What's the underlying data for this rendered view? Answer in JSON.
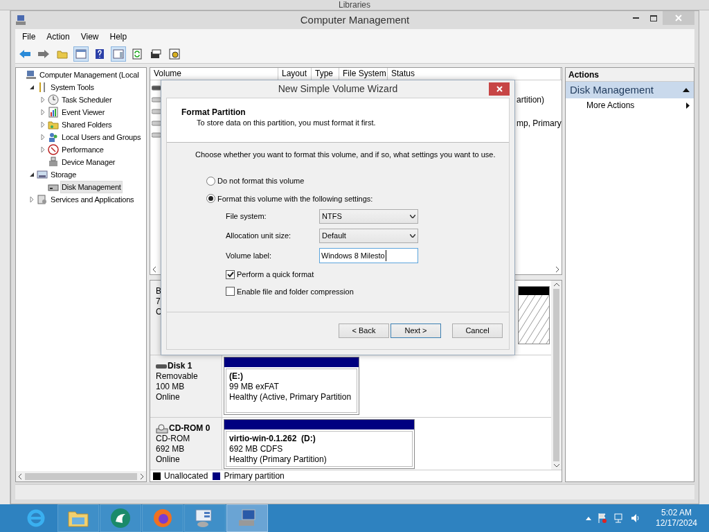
{
  "background_window": {
    "title": "Libraries"
  },
  "window": {
    "title": "Computer Management"
  },
  "menu": [
    "File",
    "Action",
    "View",
    "Help"
  ],
  "toolbar": [
    {
      "kind": "back",
      "pressed": false
    },
    {
      "kind": "forward",
      "pressed": false
    },
    {
      "kind": "folder",
      "pressed": false
    },
    {
      "kind": "console",
      "pressed": true
    },
    {
      "kind": "help",
      "pressed": false
    },
    {
      "kind": "panel",
      "pressed": true
    },
    {
      "kind": "refresh",
      "pressed": false
    },
    {
      "kind": "properties",
      "pressed": false
    },
    {
      "kind": "settings",
      "pressed": false
    }
  ],
  "tree": [
    {
      "label": "Computer Management (Local",
      "kind": "computer",
      "selected": false,
      "children": [
        {
          "label": "System Tools",
          "kind": "tools",
          "selected": false,
          "expanded": true,
          "children": [
            {
              "label": "Task Scheduler",
              "kind": "clock",
              "selected": false,
              "expanded": false
            },
            {
              "label": "Event Viewer",
              "kind": "log",
              "selected": false,
              "expanded": false
            },
            {
              "label": "Shared Folders",
              "kind": "folder",
              "selected": false,
              "expanded": false
            },
            {
              "label": "Local Users and Groups",
              "kind": "users",
              "selected": false,
              "expanded": false
            },
            {
              "label": "Performance",
              "kind": "gauge",
              "selected": false,
              "expanded": false
            },
            {
              "label": "Device Manager",
              "kind": "device",
              "selected": false
            }
          ]
        },
        {
          "label": "Storage",
          "kind": "storage",
          "selected": false,
          "expanded": true,
          "children": [
            {
              "label": "Disk Management",
              "kind": "disk",
              "selected": true
            }
          ]
        },
        {
          "label": "Services and Applications",
          "kind": "services",
          "selected": false,
          "expanded": false
        }
      ]
    }
  ],
  "volume_list": {
    "columns": [
      "Volume",
      "Layout",
      "Type",
      "File System",
      "Status"
    ],
    "rows": [
      {
        "visible_text": ""
      },
      {
        "visible_text": "artition)"
      },
      {
        "visible_text": ""
      },
      {
        "visible_text": "mp, Primary"
      },
      {
        "visible_text": ""
      }
    ]
  },
  "disks": [
    {
      "lines": [
        "B",
        "7",
        "C"
      ],
      "partitions": [
        {
          "kind": "unallocated"
        }
      ]
    },
    {
      "name": "Disk 1",
      "kind": "removable",
      "lines": [
        "Removable",
        "100 MB",
        "Online"
      ],
      "partitions": [
        {
          "kind": "primary",
          "title": "(E:)",
          "lines": [
            "99 MB exFAT",
            "Healthy (Active, Primary Partition"
          ]
        }
      ]
    },
    {
      "name": "CD-ROM 0",
      "kind": "cdrom",
      "lines": [
        "CD-ROM",
        "692 MB",
        "Online"
      ],
      "partitions": [
        {
          "kind": "primary",
          "title": "virtio-win-0.1.262  (D:)",
          "lines": [
            "692 MB CDFS",
            "Healthy (Primary Partition)"
          ]
        }
      ]
    }
  ],
  "legend": [
    {
      "label": "Unallocated",
      "color": "#000000"
    },
    {
      "label": "Primary partition",
      "color": "#000080"
    }
  ],
  "actions": {
    "title": "Actions",
    "section": "Disk Management",
    "expanded": true,
    "items": [
      "More Actions"
    ]
  },
  "dialog": {
    "title": "New Simple Volume Wizard",
    "heading": "Format Partition",
    "subheading": "To store data on this partition, you must format it first.",
    "instruction": "Choose whether you want to format this volume, and if so, what settings you want to use.",
    "options": [
      {
        "label": "Do not format this volume",
        "selected": false
      },
      {
        "label": "Format this volume with the following settings:",
        "selected": true
      }
    ],
    "fields": [
      {
        "kind": "select",
        "label": "File system:",
        "value": "NTFS"
      },
      {
        "kind": "select",
        "label": "Allocation unit size:",
        "value": "Default"
      },
      {
        "kind": "text",
        "label": "Volume label:",
        "value": "Windows 8 Milesto"
      }
    ],
    "checkboxes": [
      {
        "label": "Perform a quick format",
        "checked": true
      },
      {
        "label": "Enable file and folder compression",
        "checked": false
      }
    ],
    "buttons": [
      {
        "label": "< Back",
        "default": false
      },
      {
        "label": "Next >",
        "default": true
      },
      {
        "label": "Cancel",
        "default": false
      }
    ]
  },
  "taskbar": {
    "apps": [
      {
        "kind": "ie",
        "active": false
      },
      {
        "kind": "explorer",
        "active": false
      },
      {
        "kind": "swirl",
        "active": false
      },
      {
        "kind": "firefox",
        "active": false
      },
      {
        "kind": "server",
        "active": false
      },
      {
        "kind": "compmgmt",
        "active": true
      }
    ],
    "time": "5:02 AM",
    "date": "12/17/2024"
  }
}
